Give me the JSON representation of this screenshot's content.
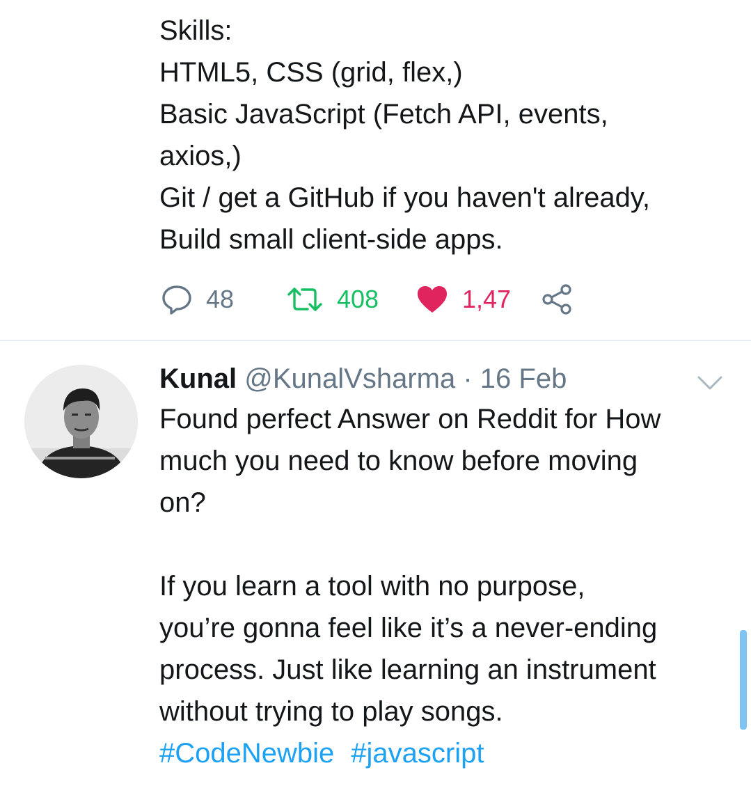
{
  "tweet1": {
    "lines": [
      "Skills:",
      "HTML5, CSS (grid, flex,)",
      "Basic JavaScript (Fetch API, events,",
      "axios,)",
      "Git / get a GitHub if you haven't already,",
      "Build small client-side apps."
    ],
    "actions": {
      "reply_count": "48",
      "retweet_count": "408",
      "like_count": "1,47"
    },
    "colors": {
      "retweet": "#17bf63",
      "like": "#e0245e",
      "muted": "#657786"
    }
  },
  "tweet2": {
    "name": "Kunal",
    "handle": "@KunalVsharma",
    "separator": "·",
    "date": "16 Feb",
    "lines": [
      "Found perfect Answer on Reddit for How",
      "much you need to know before moving",
      "on?"
    ],
    "lines2": [
      "If you learn a tool with no purpose,",
      "you’re gonna feel like it’s a never-ending",
      "process. Just like learning an instrument",
      "without trying to play songs."
    ],
    "hashtags": [
      "#CodeNewbie",
      "#javascript"
    ],
    "colors": {
      "hashtag": "#1da1f2"
    }
  },
  "icons": [
    "reply-icon",
    "retweet-icon",
    "like-icon",
    "share-icon",
    "chevron-down-icon",
    "avatar"
  ]
}
